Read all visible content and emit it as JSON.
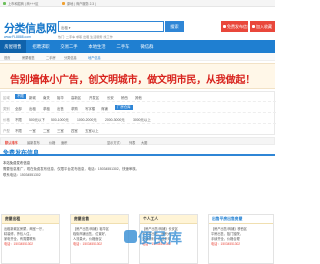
{
  "topbar": {
    "items": [
      "上市和招商 | 商+++区",
      "原地 | 商户服务 2.3 |"
    ]
  },
  "header": {
    "logo": "分类信息网",
    "logo_sub": "www.FL8888.com",
    "search_select": "出租 ▾",
    "search_placeholder": "",
    "search_button": "搜索",
    "hot_label": "热门: 二手车 求职 出租 生活服务 找工作",
    "post_button": "免费发布信息",
    "fav_button": "加入收藏"
  },
  "nav": {
    "items": [
      "房屋租售",
      "招聘求职",
      "交易二手",
      "本地生活",
      "二手车",
      "微信群"
    ],
    "active_index": 0
  },
  "breadcrumb": [
    "首页",
    "房屋租售",
    "二手房",
    "分类信息",
    "地产信息"
  ],
  "banner": {
    "text": "告别墙体小广告，创文明城市，做文明市民，从我做起！"
  },
  "filter": {
    "rows": [
      {
        "label": "区域",
        "options": [
          "不限",
          "新城",
          "南关",
          "裕华",
          "高新区",
          "开发区",
          "长安",
          "桥西",
          "其他"
        ],
        "selected": 0
      },
      {
        "label": "类别",
        "options": [
          "全部",
          "出租",
          "求租",
          "出售",
          "求购",
          "写字楼",
          "商铺",
          "厂房仓库"
        ],
        "selected": 7
      },
      {
        "label": "价格",
        "options": [
          "不限",
          "500元以下",
          "500-1000元",
          "1000-2000元",
          "2000-3000元",
          "3000元以上"
        ],
        "selected": 0
      },
      {
        "label": "户型",
        "options": [
          "不限",
          "一室",
          "二室",
          "三室",
          "四室",
          "五室以上"
        ],
        "selected": 0
      }
    ]
  },
  "sortbar": {
    "items": [
      "默认排序",
      "最新发布",
      "价格",
      "面积",
      "显示方式:",
      "列表",
      "大图"
    ],
    "selected": 0
  },
  "section": {
    "title": "免费发布信息"
  },
  "notice": {
    "line1": "本站免费发布信息",
    "line2": "需要信息推广，现在免费发布信息，仅限平台发布信息，电话：15034551302，快速审核。",
    "line3": "联系电话：15034551302"
  },
  "cards": [
    {
      "title": "房屋出租",
      "lines": [
        "出租新城区房屋，两室一厅，",
        "精装修，拎包入住，",
        "家电齐全，有需要联系",
        "电话：15034551302"
      ]
    },
    {
      "title": "房屋出售",
      "lines": [
        "【房产出售/商铺】裕华区",
        "临街商铺出售，位置好，",
        "人流量大，价格面议",
        "电话：15034551302"
      ]
    },
    {
      "title": "个人工人",
      "lines": [
        "【房产出售/商铺】长安区",
        "写字楼出售，面积大，",
        "交通便利，欢迎来电",
        "电话：15034551302"
      ]
    },
    {
      "title": "出售平房出售房屋",
      "lines": [
        "【房产出售/商铺】桥西区",
        "平房出售，独门独院，",
        "手续齐全，价格合理",
        "电话：15034551302"
      ]
    }
  ],
  "watermark": "便民库",
  "colors": {
    "brand": "#1f7fd1",
    "accent": "#e9473b",
    "banner_text": "#d8231d"
  }
}
